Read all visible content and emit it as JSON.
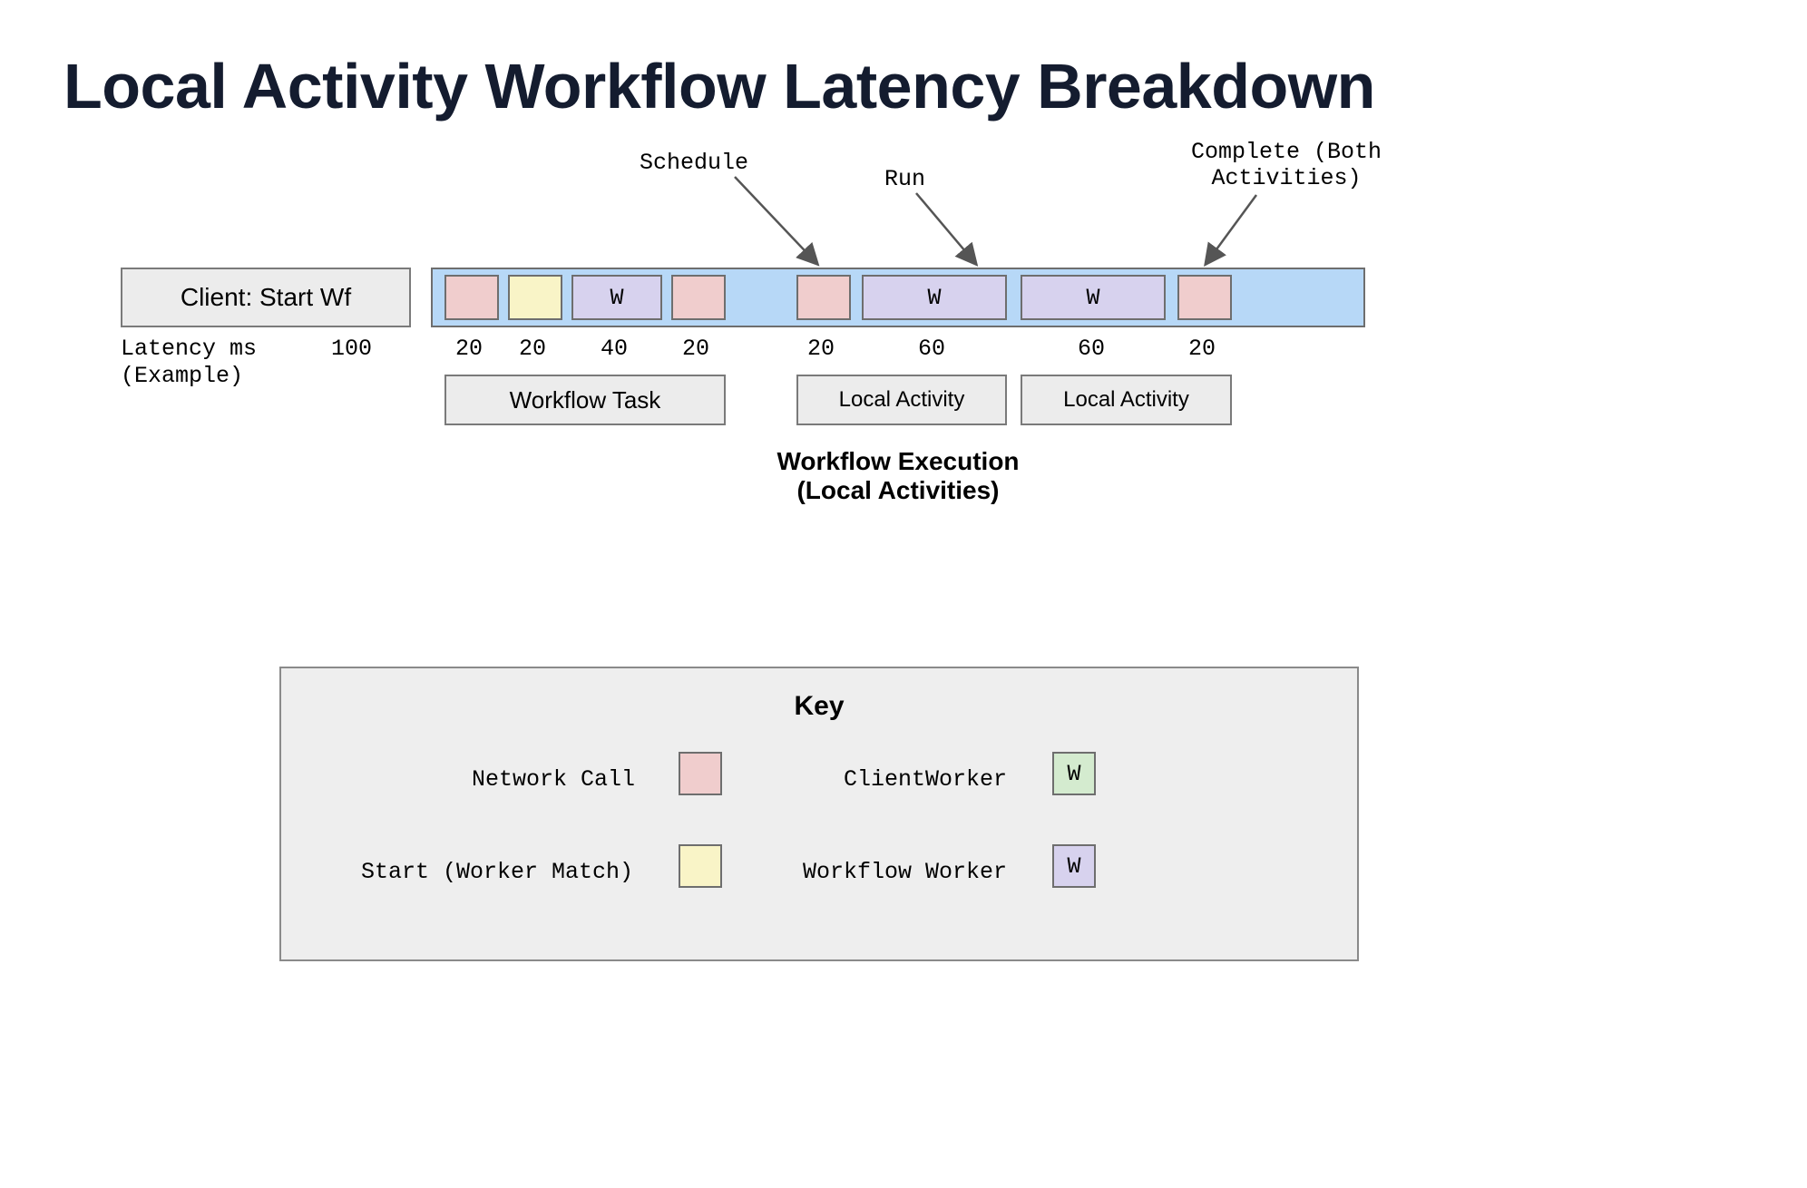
{
  "title": "Local Activity Workflow Latency Breakdown",
  "clientBox": "Client: Start Wf",
  "latencyLabelLine1": "Latency ms",
  "latencyLabelLine2": "(Example)",
  "latencies": {
    "client": "100",
    "wft_net1": "20",
    "wft_match": "20",
    "wft_worker": "40",
    "wft_net2": "20",
    "la1_sched": "20",
    "la1_run": "60",
    "la2_run": "60",
    "complete": "20"
  },
  "workerGlyph": {
    "wft": "W",
    "la1": "W",
    "la2": "W"
  },
  "groupLabels": {
    "workflowTask": "Workflow Task",
    "localActivity1": "Local Activity",
    "localActivity2": "Local Activity"
  },
  "subtitleLine1": "Workflow Execution",
  "subtitleLine2": "(Local Activities)",
  "annotations": {
    "schedule": "Schedule",
    "run": "Run",
    "complete": "Complete (Both\nActivities)"
  },
  "key": {
    "title": "Key",
    "networkCall": "Network Call",
    "start": "Start (Worker Match)",
    "clientWorker": "ClientWorker",
    "workflowWorker": "Workflow Worker",
    "clientWorkerGlyph": "W",
    "workflowWorkerGlyph": "W"
  },
  "colors": {
    "blue": "#b7d8f7",
    "pink": "#f0cdcd",
    "yellow": "#f9f4c7",
    "violet": "#d7d2ee",
    "green": "#d4ebcf"
  }
}
